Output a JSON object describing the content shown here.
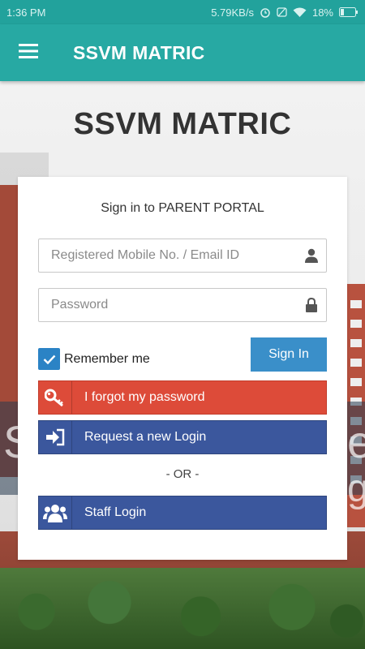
{
  "status_bar": {
    "time": "1:36 PM",
    "network_speed": "5.79KB/s",
    "battery": "18%"
  },
  "app_bar": {
    "title": "SSVM MATRIC"
  },
  "page": {
    "school_name": "SSVM MATRIC",
    "banner_left": "S",
    "banner_right_1": "e",
    "banner_right_2": "g"
  },
  "login": {
    "title": "Sign in to PARENT PORTAL",
    "username_placeholder": "Registered Mobile No. / Email ID",
    "username_value": "",
    "password_placeholder": "Password",
    "password_value": "",
    "remember_label": "Remember me",
    "remember_checked": true,
    "signin_label": "Sign In",
    "forgot_label": "I forgot my password",
    "request_label": "Request a new Login",
    "or_label": "- OR -",
    "staff_label": "Staff Login"
  },
  "colors": {
    "app_bar": "#27a9a3",
    "signin": "#3a8fc9",
    "forgot": "#dd4b39",
    "request": "#3b579d",
    "checkbox": "#2b83c5"
  },
  "icons": {
    "menu": "hamburger-icon",
    "username": "user-icon",
    "password": "lock-icon",
    "forgot": "key-icon",
    "request": "sign-in-icon",
    "staff": "users-icon"
  }
}
